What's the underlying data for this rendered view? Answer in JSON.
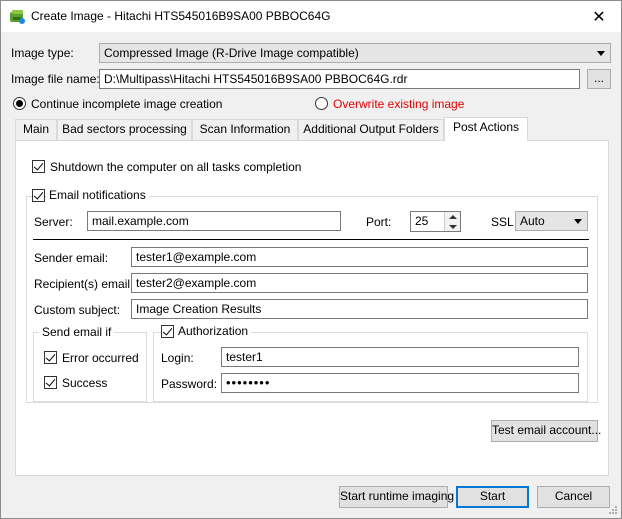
{
  "window": {
    "title": "Create Image - Hitachi HTS545016B9SA00 PBBOC64G"
  },
  "image_type": {
    "label": "Image type:",
    "value": "Compressed Image (R-Drive Image compatible)"
  },
  "image_file": {
    "label": "Image file name:",
    "value": "D:\\Multipass\\Hitachi HTS545016B9SA00 PBBOC64G.rdr",
    "browse_label": "..."
  },
  "mode": {
    "continue_label": "Continue incomplete image creation",
    "overwrite_label": "Overwrite existing image",
    "overwrite_color": "#e00000"
  },
  "tabs": [
    {
      "label": "Main"
    },
    {
      "label": "Bad sectors processing"
    },
    {
      "label": "Scan Information"
    },
    {
      "label": "Additional Output Folders"
    },
    {
      "label": "Post Actions"
    }
  ],
  "post": {
    "shutdown_label": "Shutdown the computer on all tasks completion",
    "email_label": "Email notifications",
    "server_label": "Server:",
    "server_value": "mail.example.com",
    "port_label": "Port:",
    "port_value": "25",
    "ssl_label": "SSL",
    "ssl_value": "Auto",
    "sender_label": "Sender email:",
    "sender_value": "tester1@example.com",
    "recipient_label": "Recipient(s) email:",
    "recipient_value": "tester2@example.com",
    "subject_label": "Custom subject:",
    "subject_value": "Image Creation Results",
    "send_if_title": "Send email if",
    "error_label": "Error occurred",
    "success_label": "Success",
    "auth_label": "Authorization",
    "login_label": "Login:",
    "login_value": "tester1",
    "password_label": "Password:",
    "password_value": "••••••••",
    "test_button": "Test email account..."
  },
  "footer": {
    "runtime_button": "Start runtime imaging",
    "start_button": "Start",
    "cancel_button": "Cancel"
  },
  "colors": {
    "accent": "#0078d7"
  }
}
